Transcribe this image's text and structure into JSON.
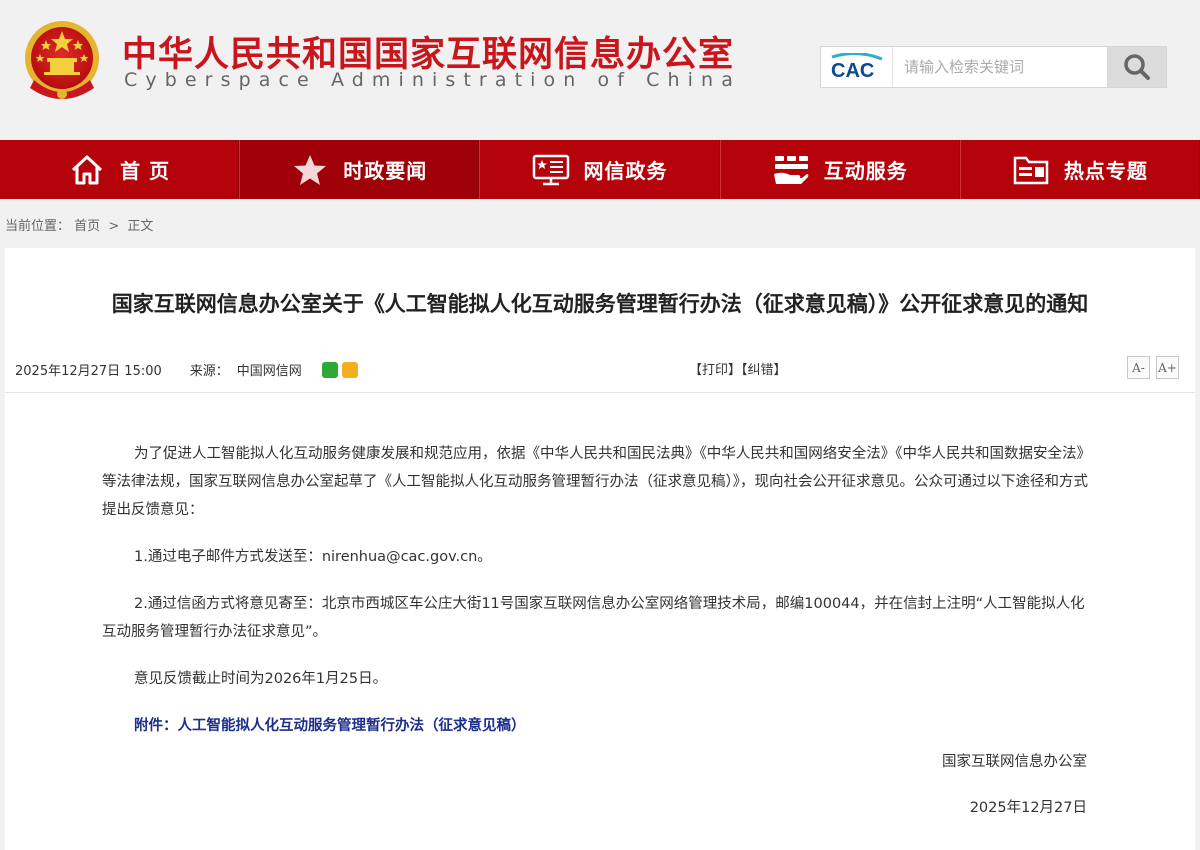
{
  "header": {
    "title_cn": "中华人民共和国国家互联网信息办公室",
    "title_en": "Cyberspace Administration of China",
    "logo_text": "CAC",
    "search_placeholder": "请输入检索关键词"
  },
  "nav": {
    "items": [
      {
        "label": "首 页",
        "icon": "home-icon"
      },
      {
        "label": "时政要闻",
        "icon": "star-icon"
      },
      {
        "label": "网信政务",
        "icon": "monitor-icon"
      },
      {
        "label": "互动服务",
        "icon": "handshake-icon"
      },
      {
        "label": "热点专题",
        "icon": "folder-icon"
      }
    ],
    "active_index": 1
  },
  "breadcrumb": {
    "label": "当前位置：",
    "home": "首页",
    "separator": ">",
    "current": "正文"
  },
  "article": {
    "title": "国家互联网信息办公室关于《人工智能拟人化互动服务管理暂行办法（征求意见稿）》公开征求意见的通知",
    "date": "2025年12月27日 15:00",
    "source_label": "来源：",
    "source": "中国网信网",
    "print_label": "【打印】",
    "correct_label": "【纠错】",
    "font_decrease": "A-",
    "font_increase": "A+",
    "paragraphs": [
      "为了促进人工智能拟人化互动服务健康发展和规范应用，依据《中华人民共和国民法典》《中华人民共和国网络安全法》《中华人民共和国数据安全法》等法律法规，国家互联网信息办公室起草了《人工智能拟人化互动服务管理暂行办法（征求意见稿）》，现向社会公开征求意见。公众可通过以下途径和方式提出反馈意见：",
      "1.通过电子邮件方式发送至：nirenhua@cac.gov.cn。",
      "2.通过信函方式将意见寄至：北京市西城区车公庄大街11号国家互联网信息办公室网络管理技术局，邮编100044，并在信封上注明“人工智能拟人化互动服务管理暂行办法征求意见”。",
      "意见反馈截止时间为2026年1月25日。"
    ],
    "attachment": "附件：人工智能拟人化互动服务管理暂行办法（征求意见稿）",
    "signature": "国家互联网信息办公室",
    "signature_date": "2025年12月27日"
  },
  "colors": {
    "brand_red": "#c8161d",
    "nav_red": "#b5030c",
    "attachment_blue": "#1d2f8c"
  }
}
